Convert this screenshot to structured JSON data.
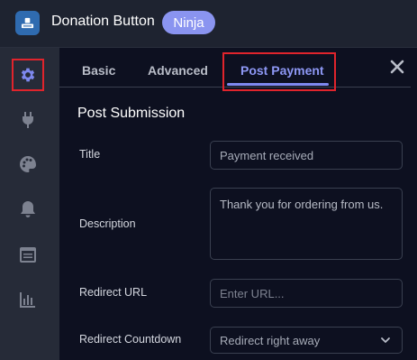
{
  "header": {
    "title": "Donation Button",
    "badge": "Ninja"
  },
  "sidebar": {
    "items": [
      {
        "icon": "gear-icon",
        "active": true
      },
      {
        "icon": "plug-icon",
        "active": false
      },
      {
        "icon": "palette-icon",
        "active": false
      },
      {
        "icon": "bell-icon",
        "active": false
      },
      {
        "icon": "calendar-icon",
        "active": false
      },
      {
        "icon": "chart-icon",
        "active": false
      }
    ]
  },
  "tabs": [
    {
      "label": "Basic",
      "active": false
    },
    {
      "label": "Advanced",
      "active": false
    },
    {
      "label": "Post Payment",
      "active": true
    }
  ],
  "section": {
    "title": "Post Submission"
  },
  "form": {
    "title_label": "Title",
    "title_value": "Payment received",
    "description_label": "Description",
    "description_value": "Thank you for ordering from us.",
    "redirect_label": "Redirect URL",
    "redirect_placeholder": "Enter URL...",
    "countdown_label": "Redirect Countdown",
    "countdown_value": "Redirect right away"
  },
  "colors": {
    "accent": "#8e98f5",
    "highlight": "#e0242c",
    "badge": "#8a94f0"
  }
}
